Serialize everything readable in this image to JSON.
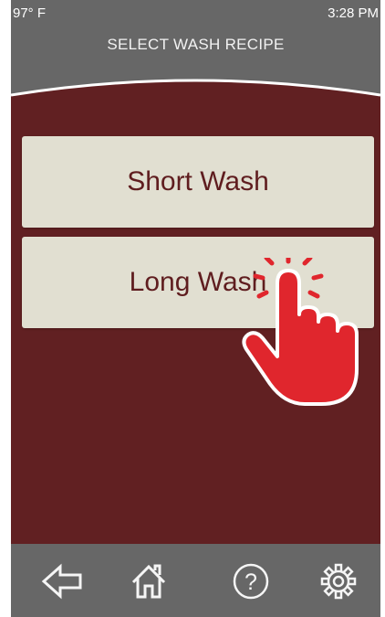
{
  "status_bar": {
    "temperature": "97° F",
    "time": "3:28 PM"
  },
  "header": {
    "title": "SELECT WASH RECIPE"
  },
  "recipes": [
    {
      "label": "Short Wash"
    },
    {
      "label": "Long Wash"
    }
  ],
  "bottom_nav": [
    {
      "icon": "back-arrow-icon"
    },
    {
      "icon": "home-icon"
    },
    {
      "icon": "help-icon"
    },
    {
      "icon": "gear-icon"
    }
  ],
  "colors": {
    "header_background": "#676767",
    "content_background": "#612022",
    "button_background": "#e1dfd1",
    "button_text": "#5f1d1f",
    "hand_pointer": "#e0262d"
  }
}
